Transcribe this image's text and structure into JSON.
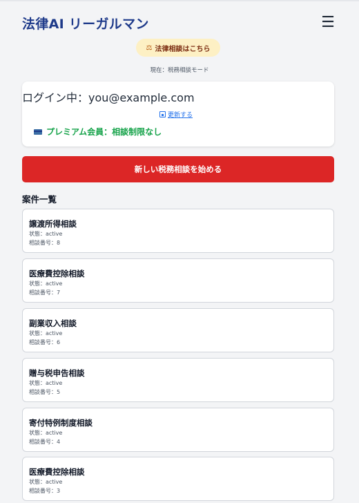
{
  "header": {
    "title": "法律AI リーガルマン",
    "menu_icon": "hamburger-menu-icon"
  },
  "law_button": {
    "icon": "⚖",
    "label": "法律相談はこちら"
  },
  "mode_text": "現在：税務相談モード",
  "user": {
    "login_text": "ログイン中：you@example.com",
    "update_label": "更新する",
    "premium_label": "プレミアム会員：相談制限なし"
  },
  "new_consult_button": "新しい税務相談を始める",
  "cases_title": "案件一覧",
  "cases": [
    {
      "title": "譲渡所得相談",
      "status": "状態：active",
      "number": "相談番号：8"
    },
    {
      "title": "医療費控除相談",
      "status": "状態：active",
      "number": "相談番号：7"
    },
    {
      "title": "副業収入相談",
      "status": "状態：active",
      "number": "相談番号：6"
    },
    {
      "title": "贈与税申告相談",
      "status": "状態：active",
      "number": "相談番号：5"
    },
    {
      "title": "寄付特例制度相談",
      "status": "状態：active",
      "number": "相談番号：4"
    },
    {
      "title": "医療費控除相談",
      "status": "状態：active",
      "number": "相談番号：3"
    }
  ],
  "colors": {
    "brand": "#1e3a8a",
    "primary_button": "#dc2626",
    "premium": "#16a34a",
    "link": "#1f6feb"
  }
}
